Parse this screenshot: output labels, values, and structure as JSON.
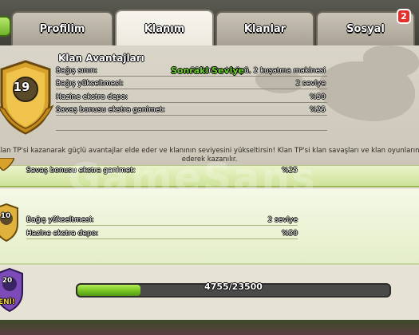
{
  "tabs": [
    {
      "label": "Profilim",
      "active": false
    },
    {
      "label": "Klanım",
      "active": true
    },
    {
      "label": "Klanlar",
      "active": false
    },
    {
      "label": "Sosyal",
      "active": false
    }
  ],
  "notification_count": "2",
  "perks": {
    "title": "Klan Avantajları",
    "current_level": "19",
    "rows": [
      {
        "label": "Bağış sınırı:",
        "value": "55 birlik, 4 büyü, 2 kuşatma makinesi"
      },
      {
        "label": "Bağış yükseltmesi:",
        "value": "2 seviye"
      },
      {
        "label": "Hazine ekstra depo:",
        "value": "%50"
      },
      {
        "label": "Savaş bonusu ekstra ganimet:",
        "value": "%25"
      }
    ],
    "description_line1": "Klan TP'si kazanarak güçlü avantajlar elde eder ve klanının seviyesini yükseltirsin! Klan TP'si klan savaşları ve klan oyunlarında reka",
    "description_line2": "ederek kazanılır."
  },
  "level_strip": {
    "row": {
      "label": "Savaş bonusu ekstra ganimet:",
      "value": "%25"
    }
  },
  "watermark": "GameSans",
  "level_10": {
    "level": "10",
    "rows": [
      {
        "label": "Bağış yükseltmesi:",
        "value": "2 seviye"
      },
      {
        "label": "Hazine ekstra depo:",
        "value": "%50"
      }
    ]
  },
  "next_level": {
    "title": "Sonraki Seviye",
    "level": "20",
    "badge_label": "ENİ!",
    "xp_text": "4755/23500",
    "progress": 0.2023
  },
  "colors": {
    "accent_green": "#6ccf2d",
    "badge_gold": "#e9b43a",
    "notif_red": "#e3302a"
  }
}
